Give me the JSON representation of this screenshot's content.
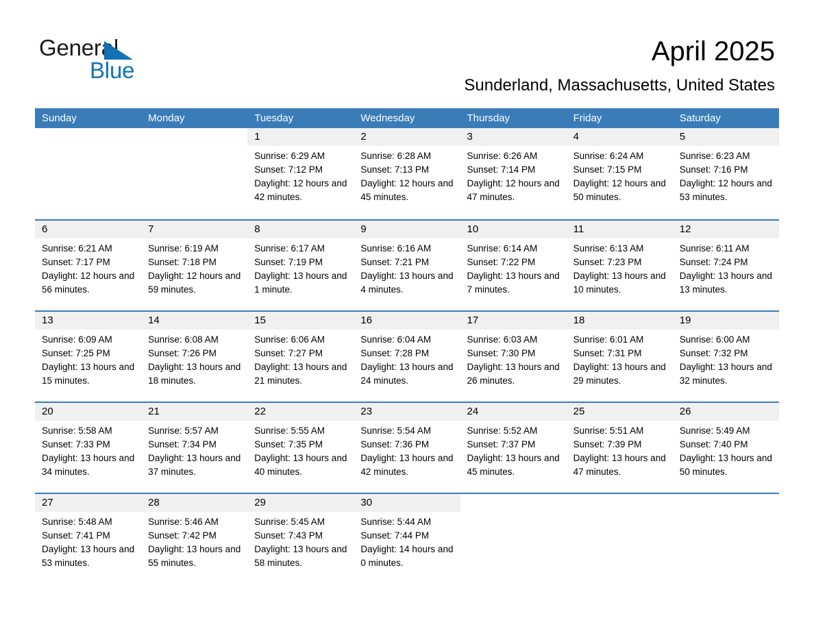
{
  "brand": {
    "name_part1": "General",
    "name_part2": "Blue",
    "triangle_color": "#1272b6"
  },
  "header": {
    "title": "April 2025",
    "location": "Sunderland, Massachusetts, United States"
  },
  "theme": {
    "header_blue": "#3a7cb8",
    "daynum_band": "#f0f0f0"
  },
  "weekdays": [
    "Sunday",
    "Monday",
    "Tuesday",
    "Wednesday",
    "Thursday",
    "Friday",
    "Saturday"
  ],
  "weeks": [
    [
      {
        "day": "",
        "sunrise": "",
        "sunset": "",
        "daylight": ""
      },
      {
        "day": "",
        "sunrise": "",
        "sunset": "",
        "daylight": ""
      },
      {
        "day": "1",
        "sunrise": "Sunrise: 6:29 AM",
        "sunset": "Sunset: 7:12 PM",
        "daylight": "Daylight: 12 hours and 42 minutes."
      },
      {
        "day": "2",
        "sunrise": "Sunrise: 6:28 AM",
        "sunset": "Sunset: 7:13 PM",
        "daylight": "Daylight: 12 hours and 45 minutes."
      },
      {
        "day": "3",
        "sunrise": "Sunrise: 6:26 AM",
        "sunset": "Sunset: 7:14 PM",
        "daylight": "Daylight: 12 hours and 47 minutes."
      },
      {
        "day": "4",
        "sunrise": "Sunrise: 6:24 AM",
        "sunset": "Sunset: 7:15 PM",
        "daylight": "Daylight: 12 hours and 50 minutes."
      },
      {
        "day": "5",
        "sunrise": "Sunrise: 6:23 AM",
        "sunset": "Sunset: 7:16 PM",
        "daylight": "Daylight: 12 hours and 53 minutes."
      }
    ],
    [
      {
        "day": "6",
        "sunrise": "Sunrise: 6:21 AM",
        "sunset": "Sunset: 7:17 PM",
        "daylight": "Daylight: 12 hours and 56 minutes."
      },
      {
        "day": "7",
        "sunrise": "Sunrise: 6:19 AM",
        "sunset": "Sunset: 7:18 PM",
        "daylight": "Daylight: 12 hours and 59 minutes."
      },
      {
        "day": "8",
        "sunrise": "Sunrise: 6:17 AM",
        "sunset": "Sunset: 7:19 PM",
        "daylight": "Daylight: 13 hours and 1 minute."
      },
      {
        "day": "9",
        "sunrise": "Sunrise: 6:16 AM",
        "sunset": "Sunset: 7:21 PM",
        "daylight": "Daylight: 13 hours and 4 minutes."
      },
      {
        "day": "10",
        "sunrise": "Sunrise: 6:14 AM",
        "sunset": "Sunset: 7:22 PM",
        "daylight": "Daylight: 13 hours and 7 minutes."
      },
      {
        "day": "11",
        "sunrise": "Sunrise: 6:13 AM",
        "sunset": "Sunset: 7:23 PM",
        "daylight": "Daylight: 13 hours and 10 minutes."
      },
      {
        "day": "12",
        "sunrise": "Sunrise: 6:11 AM",
        "sunset": "Sunset: 7:24 PM",
        "daylight": "Daylight: 13 hours and 13 minutes."
      }
    ],
    [
      {
        "day": "13",
        "sunrise": "Sunrise: 6:09 AM",
        "sunset": "Sunset: 7:25 PM",
        "daylight": "Daylight: 13 hours and 15 minutes."
      },
      {
        "day": "14",
        "sunrise": "Sunrise: 6:08 AM",
        "sunset": "Sunset: 7:26 PM",
        "daylight": "Daylight: 13 hours and 18 minutes."
      },
      {
        "day": "15",
        "sunrise": "Sunrise: 6:06 AM",
        "sunset": "Sunset: 7:27 PM",
        "daylight": "Daylight: 13 hours and 21 minutes."
      },
      {
        "day": "16",
        "sunrise": "Sunrise: 6:04 AM",
        "sunset": "Sunset: 7:28 PM",
        "daylight": "Daylight: 13 hours and 24 minutes."
      },
      {
        "day": "17",
        "sunrise": "Sunrise: 6:03 AM",
        "sunset": "Sunset: 7:30 PM",
        "daylight": "Daylight: 13 hours and 26 minutes."
      },
      {
        "day": "18",
        "sunrise": "Sunrise: 6:01 AM",
        "sunset": "Sunset: 7:31 PM",
        "daylight": "Daylight: 13 hours and 29 minutes."
      },
      {
        "day": "19",
        "sunrise": "Sunrise: 6:00 AM",
        "sunset": "Sunset: 7:32 PM",
        "daylight": "Daylight: 13 hours and 32 minutes."
      }
    ],
    [
      {
        "day": "20",
        "sunrise": "Sunrise: 5:58 AM",
        "sunset": "Sunset: 7:33 PM",
        "daylight": "Daylight: 13 hours and 34 minutes."
      },
      {
        "day": "21",
        "sunrise": "Sunrise: 5:57 AM",
        "sunset": "Sunset: 7:34 PM",
        "daylight": "Daylight: 13 hours and 37 minutes."
      },
      {
        "day": "22",
        "sunrise": "Sunrise: 5:55 AM",
        "sunset": "Sunset: 7:35 PM",
        "daylight": "Daylight: 13 hours and 40 minutes."
      },
      {
        "day": "23",
        "sunrise": "Sunrise: 5:54 AM",
        "sunset": "Sunset: 7:36 PM",
        "daylight": "Daylight: 13 hours and 42 minutes."
      },
      {
        "day": "24",
        "sunrise": "Sunrise: 5:52 AM",
        "sunset": "Sunset: 7:37 PM",
        "daylight": "Daylight: 13 hours and 45 minutes."
      },
      {
        "day": "25",
        "sunrise": "Sunrise: 5:51 AM",
        "sunset": "Sunset: 7:39 PM",
        "daylight": "Daylight: 13 hours and 47 minutes."
      },
      {
        "day": "26",
        "sunrise": "Sunrise: 5:49 AM",
        "sunset": "Sunset: 7:40 PM",
        "daylight": "Daylight: 13 hours and 50 minutes."
      }
    ],
    [
      {
        "day": "27",
        "sunrise": "Sunrise: 5:48 AM",
        "sunset": "Sunset: 7:41 PM",
        "daylight": "Daylight: 13 hours and 53 minutes."
      },
      {
        "day": "28",
        "sunrise": "Sunrise: 5:46 AM",
        "sunset": "Sunset: 7:42 PM",
        "daylight": "Daylight: 13 hours and 55 minutes."
      },
      {
        "day": "29",
        "sunrise": "Sunrise: 5:45 AM",
        "sunset": "Sunset: 7:43 PM",
        "daylight": "Daylight: 13 hours and 58 minutes."
      },
      {
        "day": "30",
        "sunrise": "Sunrise: 5:44 AM",
        "sunset": "Sunset: 7:44 PM",
        "daylight": "Daylight: 14 hours and 0 minutes."
      },
      {
        "day": "",
        "sunrise": "",
        "sunset": "",
        "daylight": ""
      },
      {
        "day": "",
        "sunrise": "",
        "sunset": "",
        "daylight": ""
      },
      {
        "day": "",
        "sunrise": "",
        "sunset": "",
        "daylight": ""
      }
    ]
  ]
}
